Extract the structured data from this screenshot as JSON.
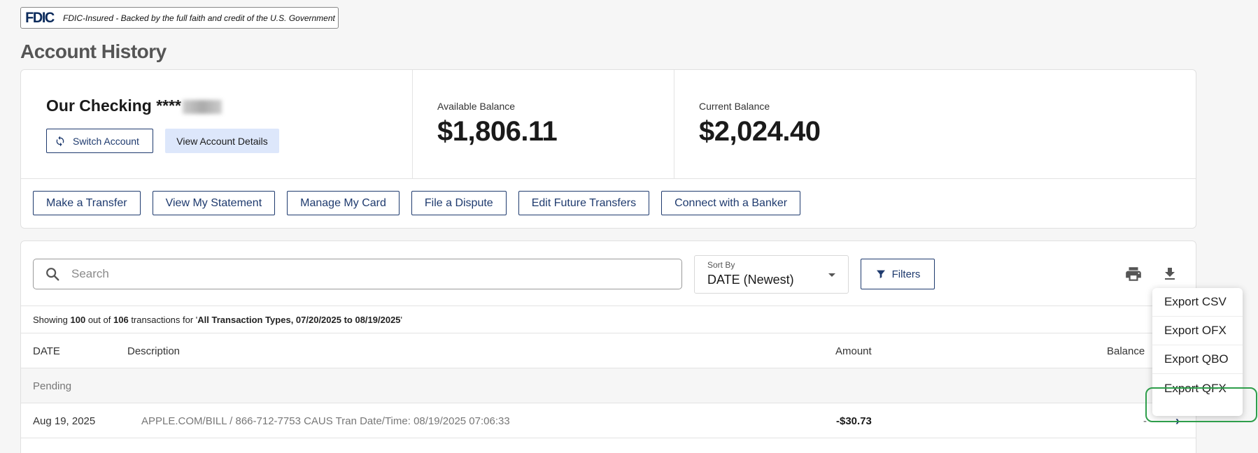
{
  "fdic": {
    "logo": "FDIC",
    "text": "FDIC-Insured - Backed by the full faith and credit of the U.S. Government"
  },
  "page_title": "Account History",
  "account": {
    "name": "Our Checking ****",
    "switch_label": "Switch Account",
    "details_label": "View Account Details",
    "available_label": "Available Balance",
    "available_value": "$1,806.11",
    "current_label": "Current Balance",
    "current_value": "$2,024.40"
  },
  "actions": [
    "Make a Transfer",
    "View My Statement",
    "Manage My Card",
    "File a Dispute",
    "Edit Future Transfers",
    "Connect with a Banker"
  ],
  "toolbar": {
    "search_placeholder": "Search",
    "sort_label": "Sort By",
    "sort_value": "DATE (Newest)",
    "filters_label": "Filters"
  },
  "showing": {
    "prefix": "Showing ",
    "count": "100",
    "mid": " out of ",
    "total": "106",
    "mid2": " transactions for '",
    "range": "All Transaction Types, 07/20/2025 to 08/19/2025",
    "suffix": "'"
  },
  "table": {
    "headers": {
      "date": "DATE",
      "description": "Description",
      "amount": "Amount",
      "balance": "Balance"
    },
    "pending_label": "Pending",
    "rows": [
      {
        "date": "Aug 19, 2025",
        "description": "APPLE.COM/BILL / 866-712-7753 CAUS Tran Date/Time: 08/19/2025 07:06:33",
        "amount": "-$30.73",
        "balance": "-"
      }
    ]
  },
  "export_menu": {
    "items": [
      "Export CSV",
      "Export OFX",
      "Export QBO",
      "Export QFX"
    ],
    "highlighted": "Export QFX",
    "highlight_color": "#2e9e4b"
  },
  "colors": {
    "accent": "#1e3a6e",
    "details_bg": "#dde7fb",
    "page_bg": "#f6f6f6"
  }
}
